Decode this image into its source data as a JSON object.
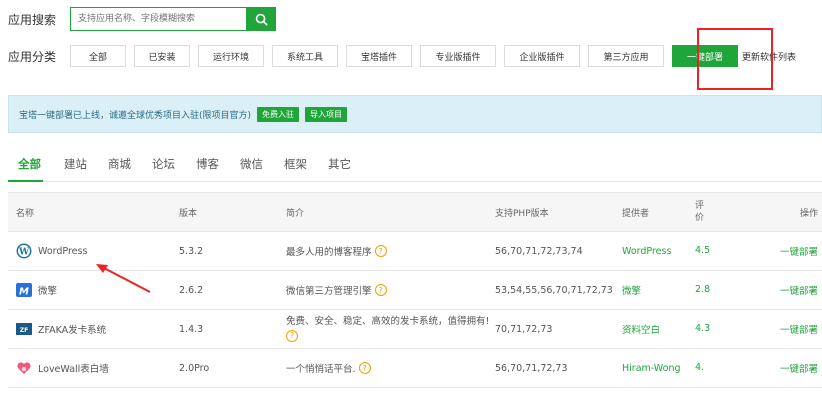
{
  "search": {
    "label": "应用搜索",
    "placeholder": "支持应用名称、字段模糊搜索"
  },
  "category": {
    "label": "应用分类",
    "buttons": [
      {
        "label": "全部"
      },
      {
        "label": "已安装"
      },
      {
        "label": "运行环境"
      },
      {
        "label": "系统工具"
      },
      {
        "label": "宝塔插件"
      },
      {
        "label": "专业版插件"
      },
      {
        "label": "企业版插件"
      },
      {
        "label": "第三方应用"
      },
      {
        "label": "一键部署"
      }
    ],
    "active_index": 8,
    "update_link": "更新软件列表"
  },
  "notice": {
    "text": "宝塔一键部署已上线，诚邀全球优秀项目入驻(限项目官方)",
    "join_button": "免费入驻",
    "import_button": "导入项目"
  },
  "tabs": [
    "全部",
    "建站",
    "商城",
    "论坛",
    "博客",
    "微信",
    "框架",
    "其它"
  ],
  "table": {
    "headers": {
      "name": "名称",
      "version": "版本",
      "desc": "简介",
      "php": "支持PHP版本",
      "provider": "提供者",
      "score": "评价",
      "op": "操作"
    },
    "rows": [
      {
        "icon": "wordpress-icon",
        "name": "WordPress",
        "version": "5.3.2",
        "desc": "最多人用的博客程序",
        "php": "56,70,71,72,73,74",
        "provider": "WordPress",
        "score": "4.5",
        "op": "一键部署"
      },
      {
        "icon": "weiqing-icon",
        "name": "微擎",
        "version": "2.6.2",
        "desc": "微信第三方管理引擎",
        "php": "53,54,55,56,70,71,72,73",
        "provider": "微擎",
        "score": "2.8",
        "op": "一键部署"
      },
      {
        "icon": "zfaka-icon",
        "name": "ZFAKA发卡系统",
        "version": "1.4.3",
        "desc": "免费、安全、稳定、高效的发卡系统，值得拥有!",
        "php": "70,71,72,73",
        "provider": "资料空白",
        "score": "4.3",
        "op": "一键部署"
      },
      {
        "icon": "lovewall-icon",
        "name": "LoveWall表白墙",
        "version": "2.0Pro",
        "desc": "一个悄悄话平台.",
        "php": "56,70,71,72,73",
        "provider": "Hiram-Wong",
        "score": "4.",
        "op": "一键部署"
      }
    ]
  },
  "colors": {
    "accent": "#20a53a",
    "highlight": "#e22222",
    "notice_bg": "#dbeff6"
  }
}
